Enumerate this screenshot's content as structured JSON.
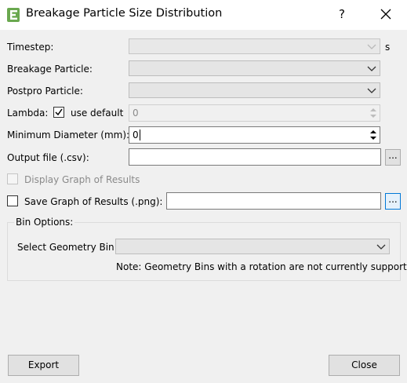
{
  "window": {
    "title": "Breakage Particle Size Distribution",
    "help_glyph": "?",
    "close_icon": "close-icon"
  },
  "form": {
    "timestep_label": "Timestep:",
    "timestep_value": "",
    "timestep_unit": "s",
    "breakage_particle_label": "Breakage Particle:",
    "breakage_particle_value": "",
    "postpro_particle_label": "Postpro Particle:",
    "postpro_particle_value": "",
    "lambda_label": "Lambda:",
    "lambda_use_default_label": "use default",
    "lambda_use_default_checked": true,
    "lambda_value": "0",
    "min_diameter_label": "Minimum Diameter (mm):",
    "min_diameter_value": "0",
    "output_file_label": "Output file (.csv):",
    "output_file_value": "",
    "browse_label": "...",
    "display_graph_label": "Display Graph of Results",
    "display_graph_checked": false,
    "save_graph_label": "Save Graph of Results (.png):",
    "save_graph_checked": false,
    "save_graph_path": "",
    "save_browse_label": "..."
  },
  "bin_options": {
    "title": "Bin Options:",
    "geometry_bin_label": "Select Geometry Bin:",
    "geometry_bin_value": "",
    "note": "Note: Geometry Bins with a rotation are not currently support"
  },
  "buttons": {
    "export_label": "Export",
    "close_label": "Close"
  },
  "colors": {
    "accent": "#0078d7",
    "app_icon_green": "#6aa84f",
    "window_bg": "#f0f0f0"
  }
}
